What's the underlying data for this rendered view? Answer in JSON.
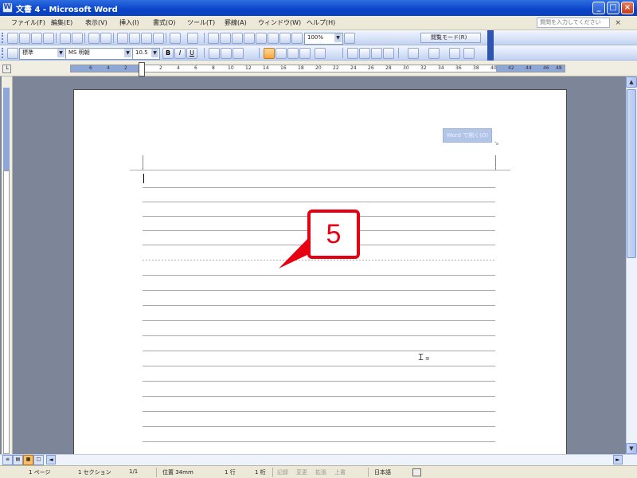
{
  "window": {
    "title": "文書 4 - Microsoft Word",
    "controls": {
      "minimize": "_",
      "maximize": "□",
      "close": "×"
    }
  },
  "menu": {
    "items": [
      "ファイル(F)",
      "編集(E)",
      "表示(V)",
      "挿入(I)",
      "書式(O)",
      "ツール(T)",
      "罫線(A)",
      "ウィンドウ(W)",
      "ヘルプ(H)"
    ],
    "help_placeholder": "質問を入力してください",
    "help_close": "×"
  },
  "toolbar_standard": {
    "zoom": "100%",
    "reading_mode": "閲覧モード(R)"
  },
  "toolbar_format": {
    "style": "標準",
    "font": "MS 明朝",
    "size": "10.5",
    "bold": "B",
    "italic": "I",
    "underline": "U"
  },
  "ruler": {
    "numbers": [
      "6",
      "4",
      "2",
      "2",
      "4",
      "6",
      "8",
      "10",
      "12",
      "14",
      "16",
      "18",
      "20",
      "22",
      "24",
      "26",
      "28",
      "30",
      "32",
      "34",
      "36",
      "38",
      "40",
      "42",
      "44",
      "46",
      "48"
    ]
  },
  "document": {
    "ghost_button_text": "Word で開く(O)",
    "grid_line_count": 18
  },
  "annotation": {
    "number": "5",
    "color": "#e60012"
  },
  "view_buttons": [
    "≡",
    "▤",
    "▦",
    "□"
  ],
  "statusbar": {
    "page": "1 ページ",
    "section": "1 セクション",
    "page_of": "1/1",
    "position": "位置 34mm",
    "line": "1 行",
    "column": "1 桁",
    "rec": "記録",
    "trk": "変更",
    "ext": "拡張",
    "ovr": "上書",
    "language": "日本語"
  }
}
